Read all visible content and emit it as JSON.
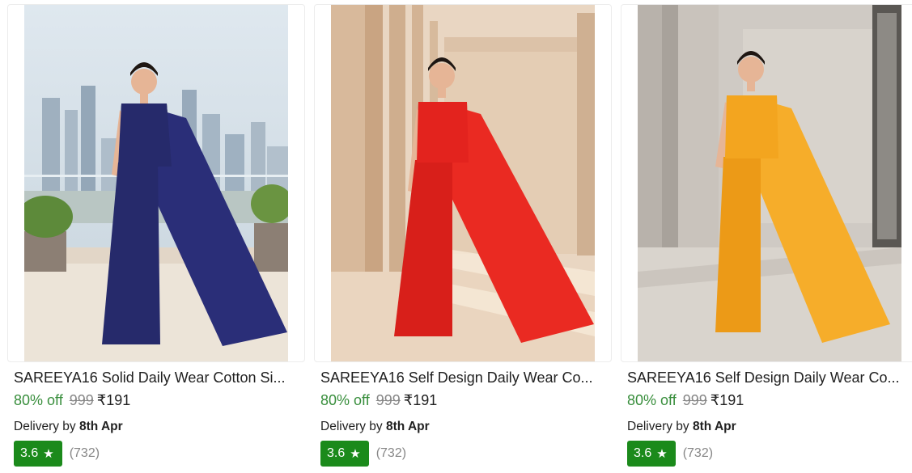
{
  "products": [
    {
      "title": "SAREEYA16 Solid Daily Wear Cotton Si...",
      "discount": "80% off",
      "mrp": "999",
      "price": "₹191",
      "delivery_prefix": "Delivery by",
      "delivery_date": "8th Apr",
      "rating": "3.6",
      "rating_count": "(732)",
      "saree_color": "#262a6b"
    },
    {
      "title": "SAREEYA16 Self Design Daily Wear Co...",
      "discount": "80% off",
      "mrp": "999",
      "price": "₹191",
      "delivery_prefix": "Delivery by",
      "delivery_date": "8th Apr",
      "rating": "3.6",
      "rating_count": "(732)",
      "saree_color": "#e3231e"
    },
    {
      "title": "SAREEYA16 Self Design Daily Wear Co...",
      "discount": "80% off",
      "mrp": "999",
      "price": "₹191",
      "delivery_prefix": "Delivery by",
      "delivery_date": "8th Apr",
      "rating": "3.6",
      "rating_count": "(732)",
      "saree_color": "#f3a51f"
    }
  ],
  "icons": {
    "rating": "star-icon"
  },
  "colors": {
    "discount": "#388e3c",
    "rating_badge": "#1b8a1b",
    "muted": "#878787"
  }
}
